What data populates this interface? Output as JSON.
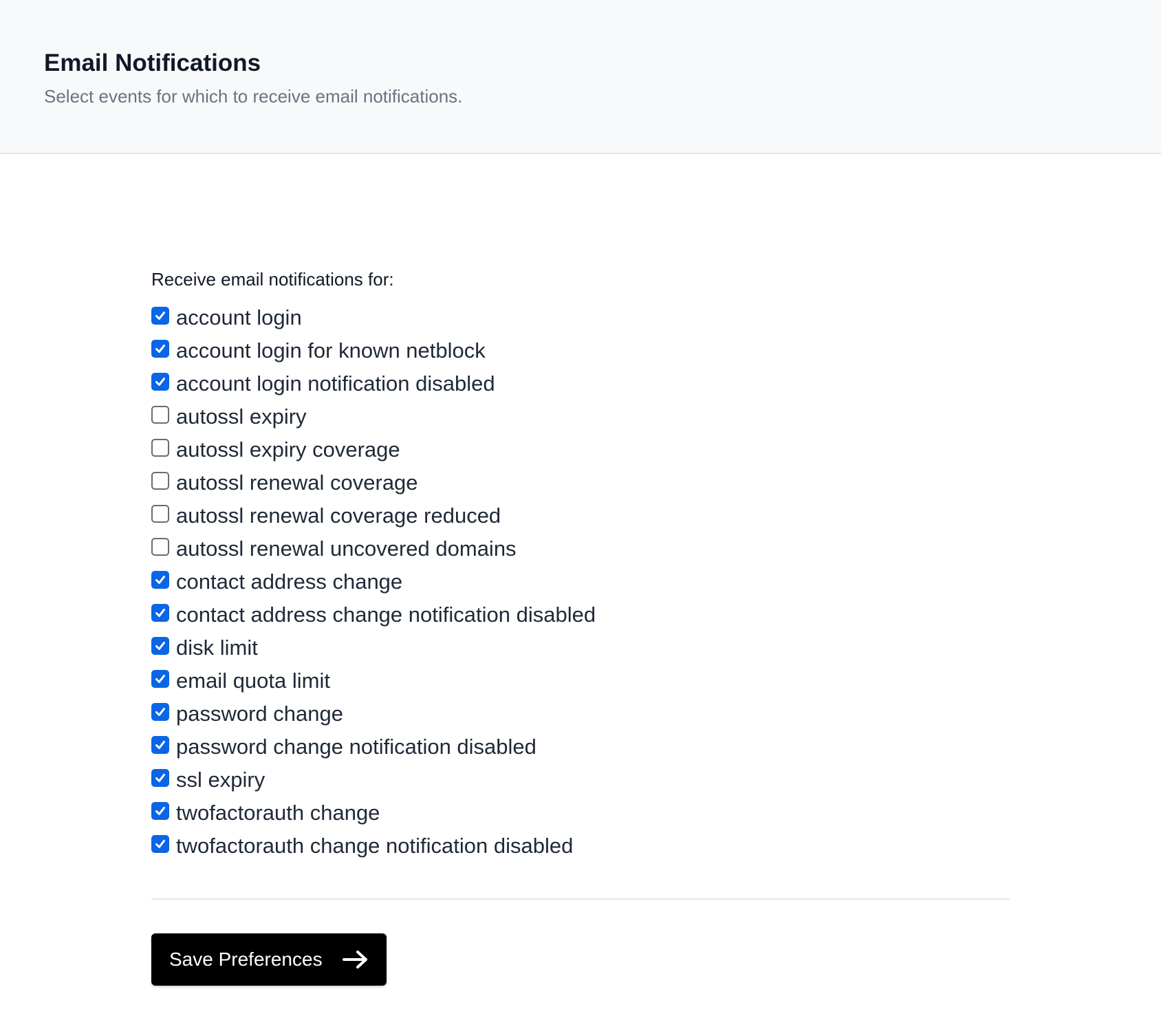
{
  "header": {
    "title": "Email Notifications",
    "subtitle": "Select events for which to receive email notifications."
  },
  "form": {
    "section_label": "Receive email notifications for:",
    "options": [
      {
        "label": "account login",
        "checked": true
      },
      {
        "label": "account login for known netblock",
        "checked": true
      },
      {
        "label": "account login notification disabled",
        "checked": true
      },
      {
        "label": "autossl expiry",
        "checked": false
      },
      {
        "label": "autossl expiry coverage",
        "checked": false
      },
      {
        "label": "autossl renewal coverage",
        "checked": false
      },
      {
        "label": "autossl renewal coverage reduced",
        "checked": false
      },
      {
        "label": "autossl renewal uncovered domains",
        "checked": false
      },
      {
        "label": "contact address change",
        "checked": true
      },
      {
        "label": "contact address change notification disabled",
        "checked": true
      },
      {
        "label": "disk limit",
        "checked": true
      },
      {
        "label": "email quota limit",
        "checked": true
      },
      {
        "label": "password change",
        "checked": true
      },
      {
        "label": "password change notification disabled",
        "checked": true
      },
      {
        "label": "ssl expiry",
        "checked": true
      },
      {
        "label": "twofactorauth change",
        "checked": true
      },
      {
        "label": "twofactorauth change notification disabled",
        "checked": true
      }
    ],
    "save_label": "Save Preferences",
    "save_icon": "arrow-right-icon"
  },
  "colors": {
    "accent": "#0a66e6",
    "header_bg": "#f8f9fb",
    "button_bg": "#000000"
  }
}
